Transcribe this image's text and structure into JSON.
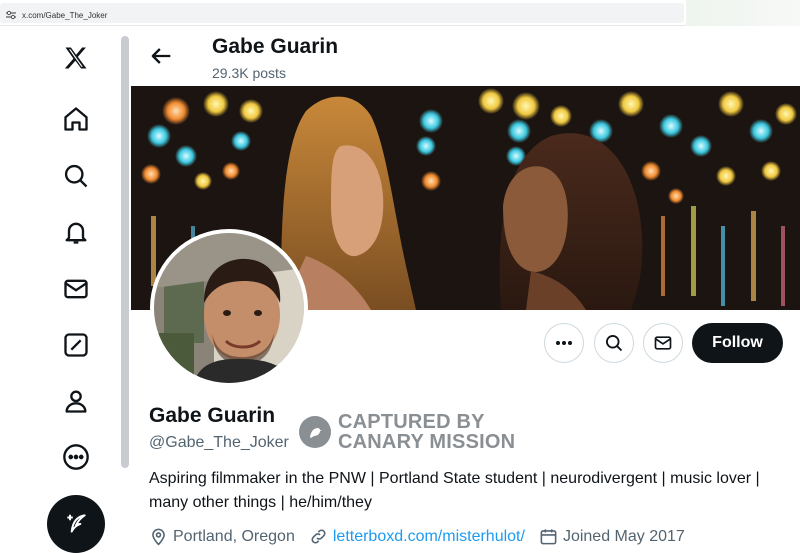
{
  "browser": {
    "url": "x.com/Gabe_The_Joker"
  },
  "nav": {
    "items": [
      {
        "name": "x-logo-icon"
      },
      {
        "name": "home-icon"
      },
      {
        "name": "search-icon"
      },
      {
        "name": "notifications-icon"
      },
      {
        "name": "messages-icon"
      },
      {
        "name": "grok-icon"
      },
      {
        "name": "profile-icon"
      },
      {
        "name": "more-icon"
      }
    ],
    "compose_icon": "compose-post-icon"
  },
  "header": {
    "title": "Gabe Guarin",
    "posts": "29.3K posts"
  },
  "actions": {
    "follow_label": "Follow"
  },
  "profile": {
    "name": "Gabe Guarin",
    "handle": "@Gabe_The_Joker",
    "stamp_line1": "CAPTURED BY",
    "stamp_line2": "CANARY MISSION",
    "bio": "Aspiring filmmaker in the PNW | Portland State student | neurodivergent | music lover | many other things | he/him/they",
    "location": "Portland, Oregon",
    "website": "letterboxd.com/misterhulot/",
    "joined": "Joined May 2017"
  },
  "colors": {
    "text": "#0f1419",
    "secondary": "#536471",
    "link": "#1d9bf0",
    "button_dark": "#0f1419"
  }
}
